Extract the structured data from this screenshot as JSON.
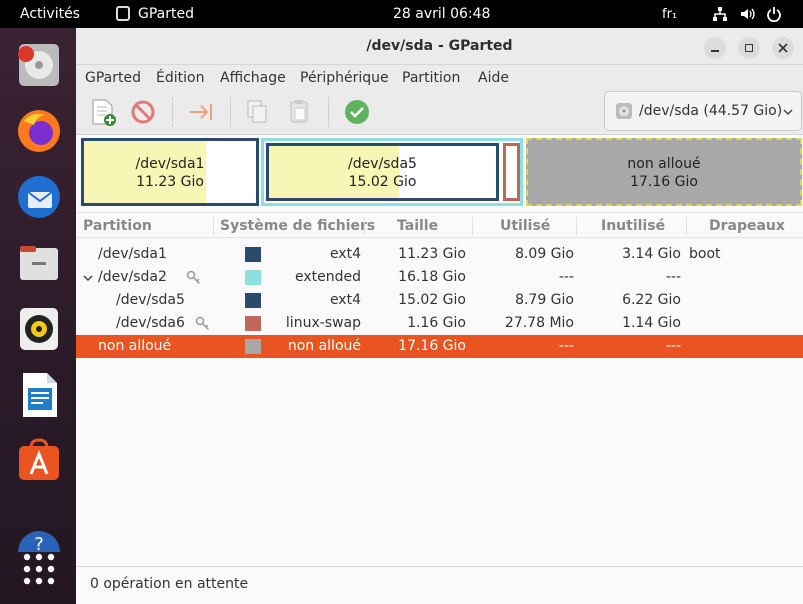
{
  "topbar": {
    "activities": "Activités",
    "clock": "28 avril  06:48",
    "lang": "fr₁"
  },
  "window": {
    "title": "/dev/sda - GParted",
    "app_name": "GParted"
  },
  "menu": [
    "GParted",
    "Édition",
    "Affichage",
    "Périphérique",
    "Partition",
    "Aide"
  ],
  "device_selector": "/dev/sda (44.57 Gio)",
  "visual": {
    "sda1": {
      "name": "/dev/sda1",
      "size": "11.23 Gio"
    },
    "sda5": {
      "name": "/dev/sda5",
      "size": "15.02 Gio"
    },
    "unalloc": {
      "name": "non alloué",
      "size": "17.16 Gio"
    }
  },
  "columns": [
    "Partition",
    "Système de fichiers",
    "Taille",
    "Utilisé",
    "Inutilisé",
    "Drapeaux"
  ],
  "rows": [
    {
      "partition": "/dev/sda1",
      "fs": "ext4",
      "size": "11.23 Gio",
      "used": "8.09 Gio",
      "unused": "3.14 Gio",
      "flags": "boot",
      "color": "#2c4a6b"
    },
    {
      "partition": "/dev/sda2",
      "fs": "extended",
      "size": "16.18 Gio",
      "used": "---",
      "unused": "---",
      "flags": "",
      "color": "#8ee0e0"
    },
    {
      "partition": "/dev/sda5",
      "fs": "ext4",
      "size": "15.02 Gio",
      "used": "8.79 Gio",
      "unused": "6.22 Gio",
      "flags": "",
      "color": "#2c4a6b"
    },
    {
      "partition": "/dev/sda6",
      "fs": "linux-swap",
      "size": "1.16 Gio",
      "used": "27.78 Mio",
      "unused": "1.14 Gio",
      "flags": "",
      "color": "#c0675a"
    },
    {
      "partition": "non alloué",
      "fs": "non alloué",
      "size": "17.16 Gio",
      "used": "---",
      "unused": "---",
      "flags": "",
      "color": "#a8a8a8"
    }
  ],
  "status": "0 opération en attente",
  "colors": {
    "accent": "#e95420",
    "ext4": "#2c4a6b",
    "extended": "#8ee0e0",
    "swap": "#c0675a",
    "unallocated": "#a8a8a8"
  }
}
